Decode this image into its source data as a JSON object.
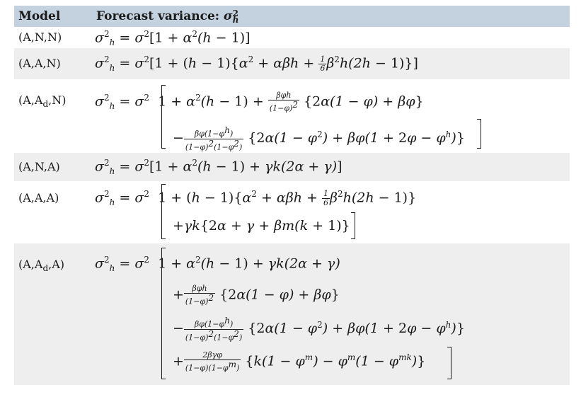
{
  "header": {
    "model": "Model",
    "title": "Forecast variance: σ²ₕ"
  },
  "rows": [
    {
      "model": "(A,N,N)",
      "lines": [
        "σ²ₕ = σ²[1 + α²(h − 1)]"
      ]
    },
    {
      "model": "(A,A,N)",
      "lines": [
        "σ²ₕ = σ²[1 + (h − 1){α² + αβh + ⅙β²h(2h − 1)}]"
      ]
    },
    {
      "model": "(A,Ad,N)",
      "lines": [
        "σ²ₕ = σ²[1 + α²(h − 1) + βφh/(1−φ)² {2α(1 − φ) + βφ}",
        "− βφ(1−φʰ)/((1−φ)²(1−φ²)) {2α(1 − φ²) + βφ(1 + 2φ − φʰ)}]"
      ]
    },
    {
      "model": "(A,N,A)",
      "lines": [
        "σ²ₕ = σ²[1 + α²(h − 1) + γk(2α + γ)]"
      ]
    },
    {
      "model": "(A,A,A)",
      "lines": [
        "σ²ₕ = σ²[1 + (h − 1){α² + αβh + ⅙β²h(2h − 1)}",
        "+γk{2α + γ + βm(k + 1)}]"
      ]
    },
    {
      "model": "(A,Ad,A)",
      "lines": [
        "σ²ₕ = σ²[1 + α²(h − 1) + γk(2α + γ)",
        "+ βφh/(1−φ)² {2α(1 − φ) + βφ}",
        "− βφ(1−φʰ)/((1−φ)²(1−φ²)) {2α(1 − φ²) + βφ(1 + 2φ − φʰ)}",
        "+ 2βγφ/((1−φ)(1−φᵐ)) {k(1 − φᵐ) − φᵐ(1 − φᵐᵏ)}]"
      ]
    }
  ]
}
